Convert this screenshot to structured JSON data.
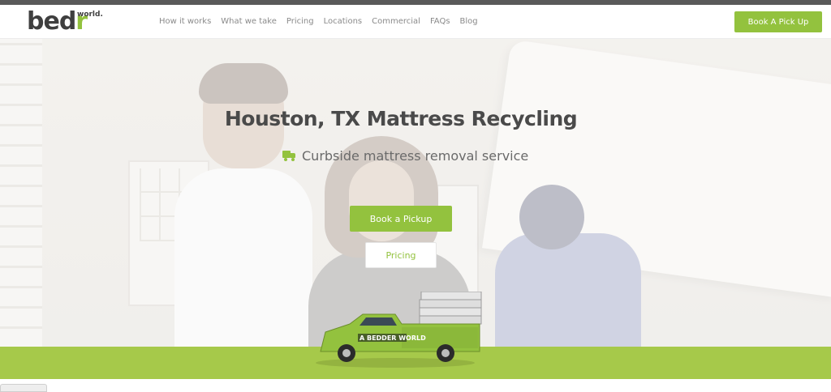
{
  "header": {
    "logo_main_left": "bed",
    "logo_main_accent": "r",
    "logo_sub": "world.",
    "nav": [
      {
        "label": "How it works"
      },
      {
        "label": "What we take"
      },
      {
        "label": "Pricing"
      },
      {
        "label": "Locations"
      },
      {
        "label": "Commercial"
      },
      {
        "label": "FAQs"
      },
      {
        "label": "Blog"
      }
    ],
    "cta_label": "Book A Pick Up"
  },
  "hero": {
    "title": "Houston, TX Mattress Recycling",
    "subtitle": "Curbside mattress removal service",
    "subtitle_icon": "truck-icon",
    "primary_button": "Book a Pickup",
    "secondary_button": "Pricing"
  },
  "truck": {
    "door_text": "A BEDDER WORLD"
  },
  "colors": {
    "brand_green": "#93c23e",
    "band_green": "#a6c94a",
    "dark_text": "#4a4a4a",
    "topbar": "#5a5a5a"
  }
}
